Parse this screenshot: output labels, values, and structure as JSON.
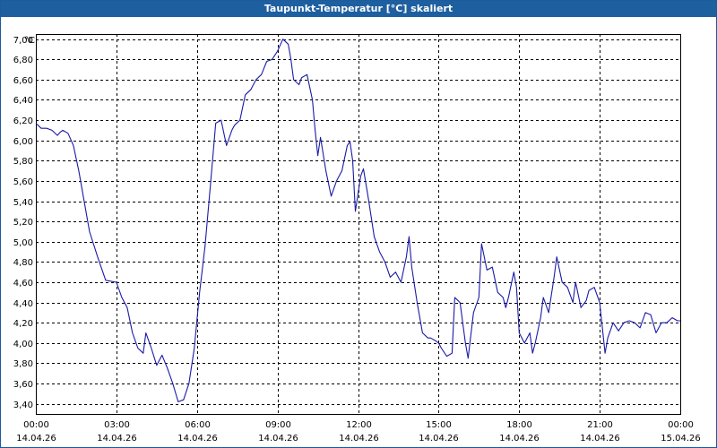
{
  "window": {
    "title": "Taupunkt-Temperatur [°C] skaliert"
  },
  "colors": {
    "titlebar": "#1e5fa0",
    "line": "#1a1aa8",
    "grid": "#000000",
    "background": "#ffffff"
  },
  "chart_data": {
    "type": "line",
    "title": "Taupunkt-Temperatur [°C] skaliert",
    "ylabel": "°C",
    "xlabel": "",
    "ylim": [
      3.3,
      7.05
    ],
    "xlim": [
      0,
      24
    ],
    "grid": true,
    "yticks": [
      3.4,
      3.6,
      3.8,
      4.0,
      4.2,
      4.4,
      4.6,
      4.8,
      5.0,
      5.2,
      5.4,
      5.6,
      5.8,
      6.0,
      6.2,
      6.4,
      6.6,
      6.8,
      7.0
    ],
    "ytick_labels": [
      "3,40",
      "3,60",
      "3,80",
      "4,00",
      "4,20",
      "4,40",
      "4,60",
      "4,80",
      "5,00",
      "5,20",
      "5,40",
      "5,60",
      "5,80",
      "6,00",
      "6,20",
      "6,40",
      "6,60",
      "6,80",
      "7,00"
    ],
    "xticks": [
      0,
      3,
      6,
      9,
      12,
      15,
      18,
      21,
      24
    ],
    "xtick_time": [
      "00:00",
      "03:00",
      "06:00",
      "09:00",
      "12:00",
      "15:00",
      "18:00",
      "21:00",
      "00:00"
    ],
    "xtick_date": [
      "14.04.26",
      "14.04.26",
      "14.04.26",
      "14.04.26",
      "14.04.26",
      "14.04.26",
      "14.04.26",
      "14.04.26",
      "15.04.26"
    ],
    "series": [
      {
        "x": [
          0,
          0.2,
          0.4,
          0.6,
          0.8,
          0.9,
          1.0,
          1.2,
          1.4,
          1.6,
          1.8,
          2.0,
          2.3,
          2.6,
          3.0,
          3.2,
          3.4,
          3.6,
          3.8,
          4.0,
          4.1,
          4.3,
          4.5,
          4.7,
          4.9,
          5.1,
          5.3,
          5.5,
          5.7,
          5.9,
          6.1,
          6.3,
          6.5,
          6.7,
          6.9,
          7.1,
          7.3,
          7.4,
          7.6,
          7.8,
          8.0,
          8.2,
          8.4,
          8.6,
          8.8,
          9.0,
          9.2,
          9.4,
          9.5,
          9.6,
          9.8,
          9.9,
          10.1,
          10.3,
          10.4,
          10.5,
          10.6,
          10.8,
          11.0,
          11.2,
          11.4,
          11.6,
          11.7,
          11.8,
          11.9,
          12.1,
          12.2,
          12.4,
          12.6,
          12.8,
          13.0,
          13.2,
          13.4,
          13.6,
          13.8,
          13.9,
          14.0,
          14.2,
          14.4,
          14.6,
          14.7,
          14.9,
          15.0,
          15.1,
          15.3,
          15.5,
          15.6,
          15.8,
          16.0,
          16.1,
          16.3,
          16.5,
          16.6,
          16.7,
          16.8,
          17.0,
          17.2,
          17.4,
          17.5,
          17.6,
          17.8,
          17.9,
          18.0,
          18.2,
          18.4,
          18.5,
          18.6,
          18.8,
          18.9,
          19.1,
          19.3,
          19.4,
          19.6,
          19.8,
          20.0,
          20.1,
          20.3,
          20.5,
          20.6,
          20.8,
          21.0,
          21.1,
          21.2,
          21.3,
          21.5,
          21.7,
          21.9,
          22.1,
          22.3,
          22.5,
          22.7,
          22.9,
          23.1,
          23.3,
          23.5,
          23.7,
          23.9,
          24.0
        ],
        "y": [
          6.17,
          6.12,
          6.12,
          6.1,
          6.05,
          6.08,
          6.1,
          6.07,
          5.95,
          5.7,
          5.4,
          5.1,
          4.85,
          4.62,
          4.6,
          4.45,
          4.35,
          4.1,
          3.95,
          3.9,
          4.1,
          3.95,
          3.78,
          3.88,
          3.75,
          3.6,
          3.42,
          3.44,
          3.6,
          3.95,
          4.5,
          4.95,
          5.55,
          6.17,
          6.2,
          5.95,
          6.1,
          6.15,
          6.2,
          6.45,
          6.5,
          6.6,
          6.65,
          6.78,
          6.8,
          6.88,
          7.0,
          6.95,
          6.8,
          6.6,
          6.55,
          6.62,
          6.65,
          6.4,
          6.1,
          5.85,
          6.03,
          5.7,
          5.45,
          5.6,
          5.7,
          5.95,
          5.99,
          5.8,
          5.3,
          5.65,
          5.72,
          5.4,
          5.05,
          4.9,
          4.8,
          4.65,
          4.7,
          4.6,
          4.85,
          5.05,
          4.75,
          4.4,
          4.1,
          4.05,
          4.05,
          4.02,
          4.0,
          3.95,
          3.87,
          3.9,
          4.45,
          4.4,
          4.0,
          3.85,
          4.3,
          4.45,
          4.98,
          4.85,
          4.72,
          4.75,
          4.5,
          4.45,
          4.35,
          4.45,
          4.7,
          4.55,
          4.1,
          4.0,
          4.1,
          3.9,
          4.0,
          4.25,
          4.45,
          4.3,
          4.65,
          4.85,
          4.6,
          4.55,
          4.4,
          4.6,
          4.35,
          4.42,
          4.52,
          4.55,
          4.4,
          4.15,
          3.9,
          4.05,
          4.2,
          4.12,
          4.2,
          4.22,
          4.2,
          4.15,
          4.3,
          4.28,
          4.1,
          4.2,
          4.2,
          4.25,
          4.22,
          4.22
        ]
      }
    ]
  }
}
